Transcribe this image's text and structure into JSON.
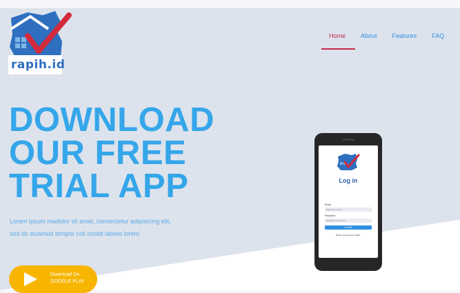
{
  "brand": {
    "logo_text": "rapih.id"
  },
  "nav": {
    "items": [
      {
        "label": "Home",
        "active": true
      },
      {
        "label": "About",
        "active": false
      },
      {
        "label": "Features",
        "active": false
      },
      {
        "label": "FAQ",
        "active": false
      }
    ]
  },
  "hero": {
    "headline": [
      "DOWNLOAD",
      "OUR FREE",
      "TRIAL APP"
    ],
    "description": "Lorem ipsum madolor sit amet, consectetur adipisicing elit, sed do elusmod tempor coli incidit labore lorem",
    "store_button": {
      "line1": "Download On",
      "line2": "GOOGLE PLAY",
      "icon": "play-icon"
    }
  },
  "phone": {
    "screen_title": "Log in",
    "email_label": "Email",
    "email_placeholder": "Masukkan Email",
    "password_label": "Password",
    "password_placeholder": "Masukkan Password",
    "login_button": "LOGIN",
    "footer_text": "Belum punya akun? daftar"
  },
  "colors": {
    "accent": "#35a6ea",
    "active_nav": "#c2294b",
    "button": "#f7b500",
    "hero_bg": "#dde3ec"
  }
}
